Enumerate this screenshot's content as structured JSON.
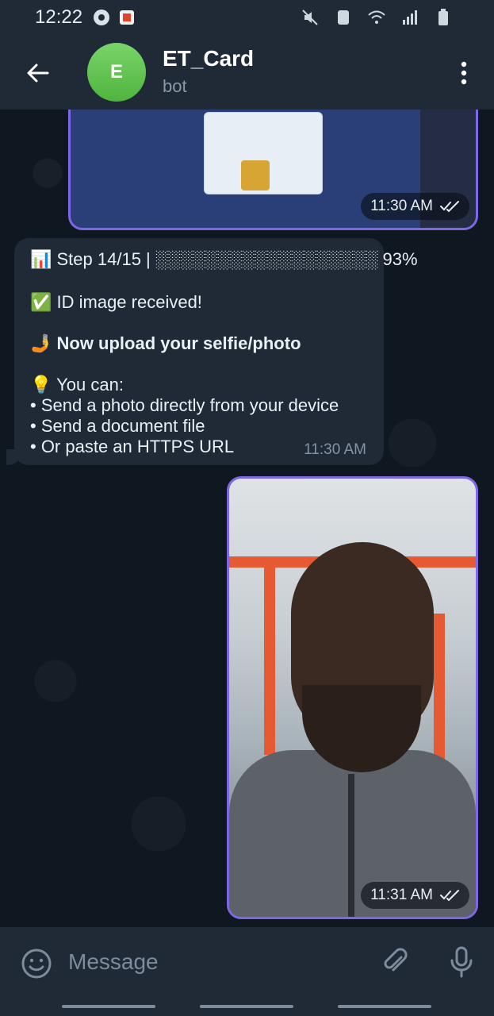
{
  "status": {
    "time": "12:22"
  },
  "header": {
    "avatar_letter": "E",
    "title": "ET_Card",
    "subtitle": "bot"
  },
  "messages": {
    "id_photo_time": "11:30 AM",
    "bot_message": {
      "progress": "📊 Step 14/15 | ░░░░░░░░░░░░░░░░░░ 93%",
      "received": "✅ ID image received!",
      "instruction": "🤳 Now upload your selfie/photo",
      "tips_title": "💡 You can:",
      "option_1": "• Send a photo directly from your device",
      "option_2": "• Send a document file",
      "option_3": "• Or paste an HTTPS URL",
      "time": "11:30 AM"
    },
    "selfie_time": "11:31 AM"
  },
  "composer": {
    "placeholder": "Message"
  },
  "icons": {
    "back": "arrow-left-icon",
    "menu": "more-vertical-icon",
    "emoji": "emoji-icon",
    "attach": "paperclip-icon",
    "mic": "microphone-icon",
    "read": "double-check-icon"
  },
  "colors": {
    "accent": "#7e67e6",
    "avatar": "#4fb43d",
    "bubble": "#1f2a36"
  }
}
